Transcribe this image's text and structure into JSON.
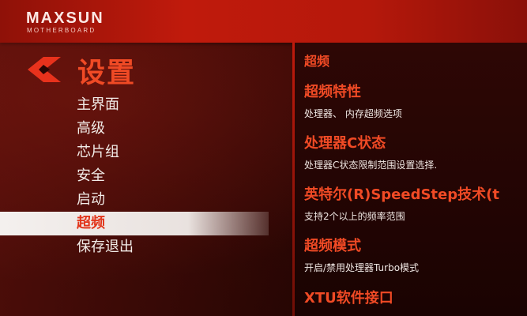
{
  "brand": {
    "name": "MAXSUN",
    "subtitle": "MOTHERBOARD"
  },
  "nav": {
    "back_icon": "back-arrow-icon",
    "title": "设置",
    "items": [
      {
        "label": "主界面"
      },
      {
        "label": "高级"
      },
      {
        "label": "芯片组"
      },
      {
        "label": "安全"
      },
      {
        "label": "启动"
      },
      {
        "label": "超频",
        "selected": true
      },
      {
        "label": "保存退出"
      }
    ]
  },
  "detail": {
    "section_title": "超频",
    "options": [
      {
        "title": "超频特性",
        "desc": "处理器、 内存超频选项"
      },
      {
        "title": "处理器C状态",
        "desc": "处理器C状态限制范围设置选择."
      },
      {
        "title": "英特尔(R)SpeedStep技术(t",
        "desc": "支持2个以上的频率范围"
      },
      {
        "title": "超频模式",
        "desc": "开启/禁用处理器Turbo模式"
      },
      {
        "title": "XTU软件接口",
        "desc": ""
      }
    ]
  },
  "colors": {
    "accent": "#f04a25",
    "header": "#c01a0c",
    "background": "#2a0604",
    "selected_bg": "#f4f0ee"
  }
}
